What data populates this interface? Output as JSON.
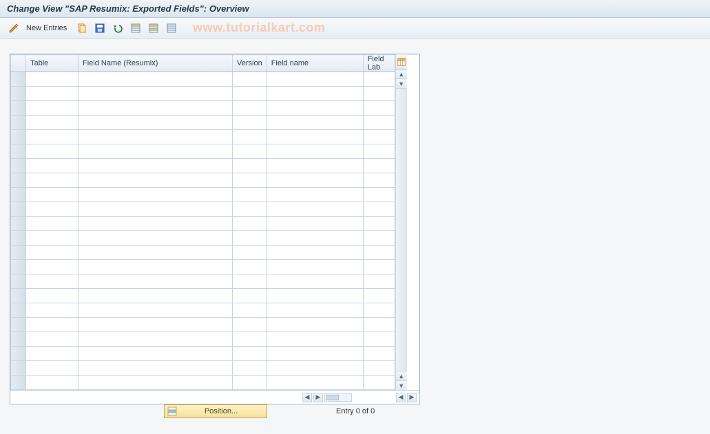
{
  "title": "Change View \"SAP Resumix: Exported Fields\": Overview",
  "watermark": "www.tutorialkart.com",
  "toolbar": {
    "new_entries_label": "New Entries",
    "icons": {
      "pencil": "pencil-icon",
      "copy": "copy-icon",
      "save": "save-icon",
      "undo": "undo-icon",
      "select_all": "select-all-icon",
      "deselect_all": "deselect-all-icon",
      "delimit": "delimit-icon"
    }
  },
  "columns": {
    "table": "Table",
    "field_resumix": "Field Name (Resumix)",
    "version": "Version",
    "field_name": "Field name",
    "field_label": "Field Lab"
  },
  "table_settings_icon": "table-settings-icon",
  "row_count": 22,
  "footer": {
    "position_label": "Position...",
    "entry_text": "Entry 0 of 0"
  }
}
